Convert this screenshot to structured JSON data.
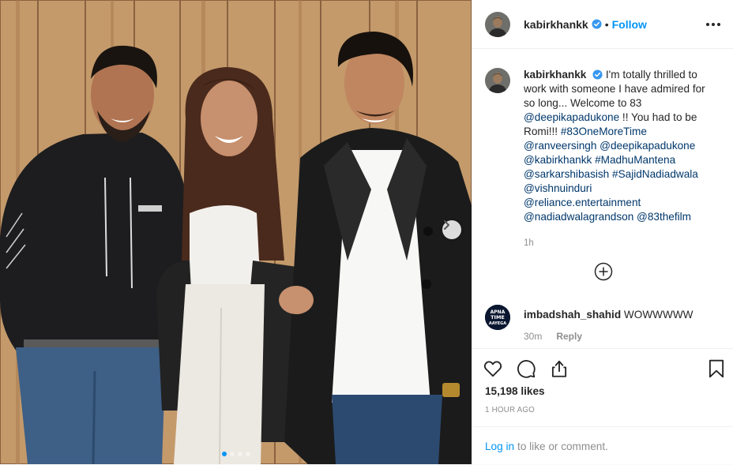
{
  "post": {
    "account": {
      "username": "kabirkhankk",
      "follow_label": "Follow",
      "separator": "•"
    },
    "caption": {
      "username": "kabirkhankk",
      "lines": [
        "I'm totally thrilled to",
        "work with someone I have admired for",
        "so long... Welcome to 83"
      ],
      "mention_line": "@deepikapadukone",
      "mention_suffix": " !! You had to be",
      "line_romi": "Romi!!! ",
      "hashtag_onemore": "#83OneMoreTime",
      "tag_lines": [
        "@ranveersingh @deepikapadukone",
        "@kabirkhankk #MadhuMantena",
        "@sarkarshibasish #SajidNadiadwala",
        "@vishnuinduri",
        "@reliance.entertainment",
        "@nadiadwalagrandson @83thefilm"
      ],
      "time": "1h"
    },
    "comment": {
      "username": "imbadshah_shahid",
      "text": "WOWWWWW",
      "avatar_text": [
        "APNA",
        "TIME",
        "AAYEGA"
      ],
      "time": "30m",
      "reply_label": "Reply"
    },
    "likes": "15,198 likes",
    "posted_ago": "1 HOUR AGO",
    "login_link": "Log in",
    "login_suffix": "to like or comment.",
    "carousel": {
      "slides": 4,
      "active_slide": 1
    },
    "colors": {
      "link_blue": "#0095f6",
      "tag_blue": "#00376b",
      "muted_gray": "#8e8e8e",
      "text_dark": "#262626",
      "verified_blue": "#3897f0"
    },
    "icons": [
      "verified-badge-icon",
      "more-options-icon",
      "chevron-right-icon",
      "plus-circle-icon",
      "heart-icon",
      "comment-icon",
      "share-icon",
      "bookmark-icon"
    ]
  }
}
